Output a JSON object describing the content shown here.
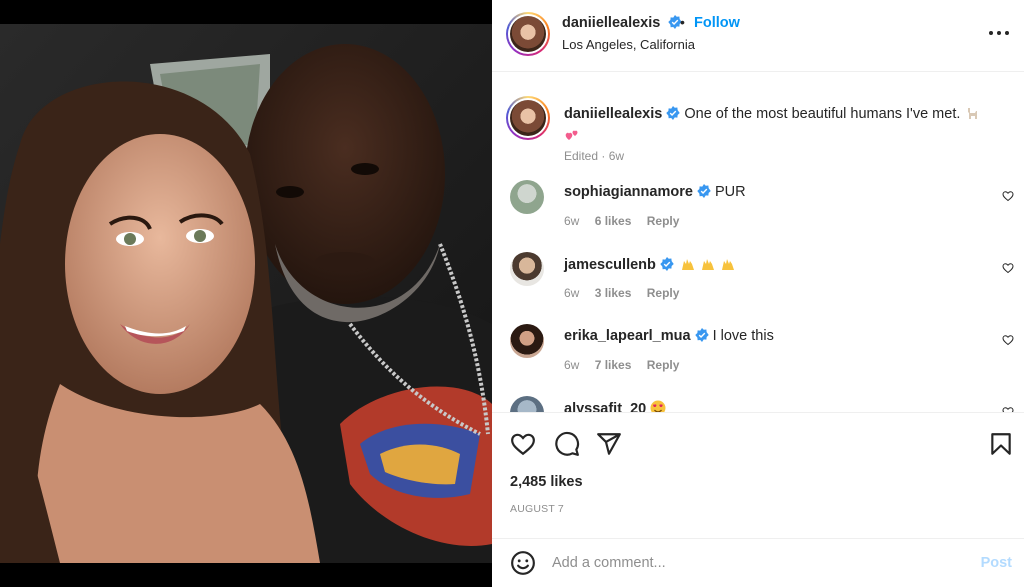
{
  "post": {
    "author": "daniiellealexis",
    "follow_label": "Follow",
    "separator": "•",
    "location": "Los Angeles, California",
    "caption_text": "One of the most beautiful humans I've met.",
    "caption_meta": "Edited · 6w",
    "likes": "2,485 likes",
    "date": "AUGUST 7"
  },
  "comments": [
    {
      "user": "sophiagiannamore",
      "text": "PUR",
      "age": "6w",
      "likes": "6 likes",
      "reply": "Reply"
    },
    {
      "user": "jamescullenb",
      "text": "",
      "age": "6w",
      "likes": "3 likes",
      "reply": "Reply"
    },
    {
      "user": "erika_lapearl_mua",
      "text": "I love this",
      "age": "6w",
      "likes": "7 likes",
      "reply": "Reply"
    },
    {
      "user": "alyssafit_20",
      "text": "",
      "age": "",
      "likes": "",
      "reply": ""
    }
  ],
  "add_comment": {
    "placeholder": "Add a comment...",
    "post_label": "Post"
  },
  "icons": {
    "more": "more-icon",
    "like": "heart-icon",
    "comment": "comment-icon",
    "share": "share-icon",
    "save": "bookmark-icon",
    "emoji": "smiley-icon",
    "verified": "verified-badge-icon"
  },
  "colors": {
    "accent": "#0095f6",
    "post_disabled": "#b3dbff",
    "verified": "#3897f0"
  }
}
